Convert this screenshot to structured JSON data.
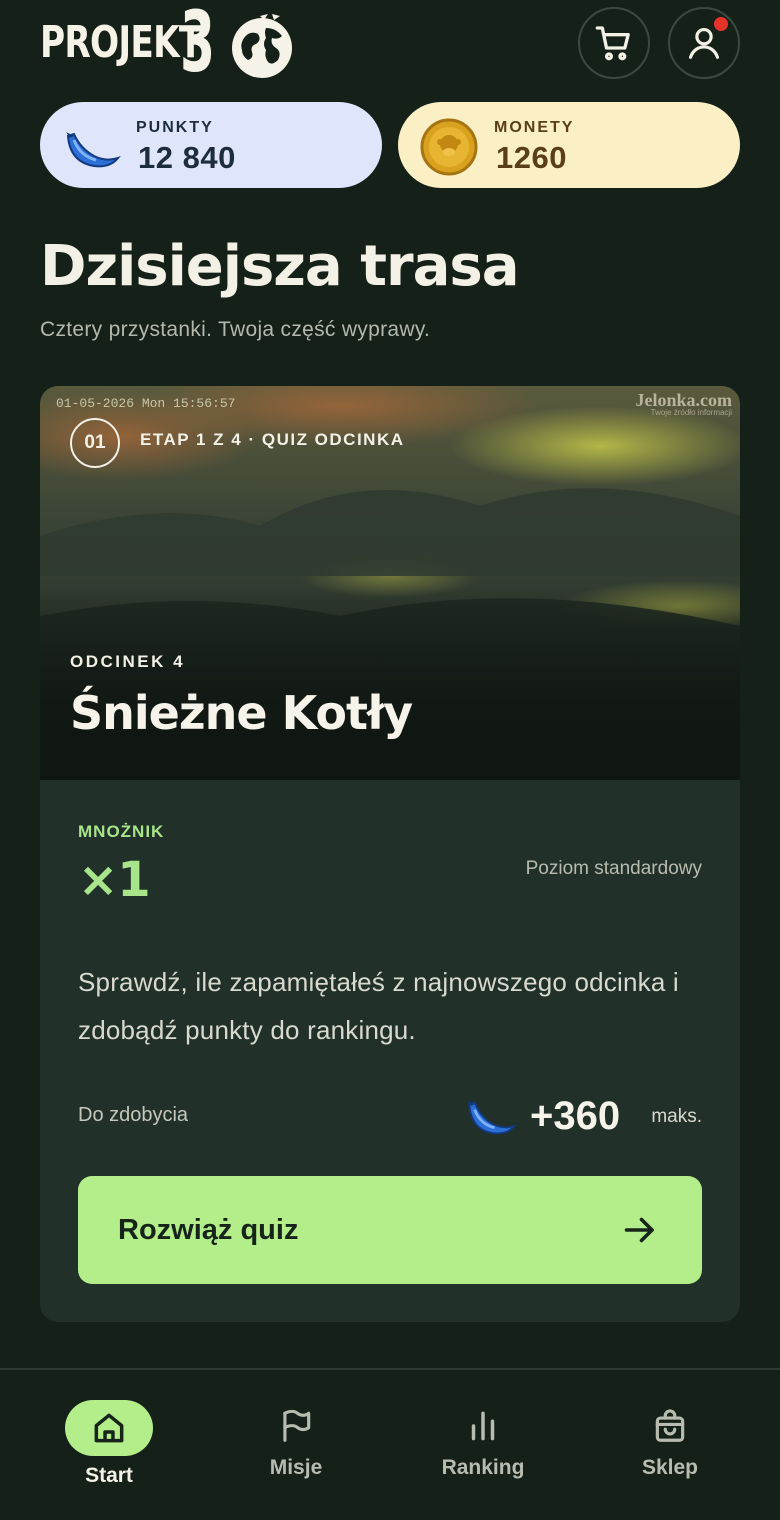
{
  "brand": {
    "logo_text": "PROJEKT",
    "logo_number": "3"
  },
  "header": {
    "cart_icon": "cart-icon",
    "user_icon": "user-icon",
    "has_notification": true
  },
  "stats": {
    "points": {
      "label": "PUNKTY",
      "value": "12 840",
      "icon": "banana-icon",
      "bg": "#dfe6fb"
    },
    "coins": {
      "label": "MONETY",
      "value": "1260",
      "icon": "coin-icon",
      "bg": "#fbefc6"
    }
  },
  "section": {
    "title": "Dzisiejsza trasa",
    "subtitle": "Cztery przystanki. Twoja część wyprawy."
  },
  "card": {
    "camera_timestamp": "01-05-2026 Mon 15:56:57",
    "watermark": "Jelonka.com",
    "watermark_sub": "Twoje źródło informacji",
    "stage_number": "01",
    "stage_label": "ETAP 1 Z 4 · QUIZ ODCINKA",
    "episode_label": "ODCINEK 4",
    "episode_title": "Śnieżne Kotły",
    "multiplier_label": "MNOŻNIK",
    "multiplier_value": "×1",
    "level": "Poziom standardowy",
    "description": "Sprawdź, ile zapamiętałeś z najnowszego odcinka i zdobądź punkty do rankingu.",
    "reward_label": "Do zdobycia",
    "reward_value": "+360",
    "reward_suffix": "maks.",
    "cta_label": "Rozwiąż quiz"
  },
  "nav": {
    "items": [
      {
        "label": "Start",
        "icon": "home-icon",
        "active": true
      },
      {
        "label": "Misje",
        "icon": "flag-icon",
        "active": false
      },
      {
        "label": "Ranking",
        "icon": "bar-chart-icon",
        "active": false
      },
      {
        "label": "Sklep",
        "icon": "shopping-bag-icon",
        "active": false
      }
    ]
  },
  "colors": {
    "background": "#152019",
    "accent": "#b3ee8a",
    "card": "#213029",
    "notification": "#e6332a"
  }
}
